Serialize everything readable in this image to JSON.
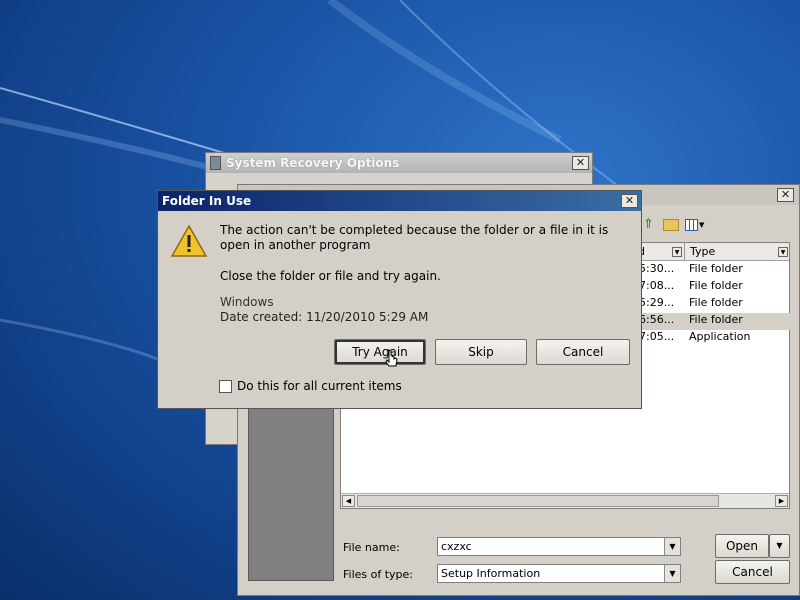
{
  "recovery_window": {
    "title": "System Recovery Options",
    "close": "✕"
  },
  "open_dialog": {
    "close": "✕",
    "columns": [
      {
        "label": "d",
        "name": "column-date-modified"
      },
      {
        "label": "Type",
        "name": "column-type"
      }
    ],
    "rows": [
      {
        "time": "5:30...",
        "type": "File folder"
      },
      {
        "time": "7:08...",
        "type": "File folder"
      },
      {
        "time": "5:29...",
        "type": "File folder"
      },
      {
        "time": "6:56...",
        "type": "File folder"
      },
      {
        "time": "7:05...",
        "type": "Application"
      }
    ],
    "file_name_label": "File name:",
    "file_name_value": "cxzxc",
    "files_of_type_label": "Files of type:",
    "files_of_type_value": "Setup Information",
    "open_button": "Open",
    "cancel_button": "Cancel"
  },
  "folder_in_use": {
    "title": "Folder In Use",
    "close": "✕",
    "message": "The action can't be completed because the folder or a file in it is open in another program",
    "instruction": "Close the folder or file and try again.",
    "item_name": "Windows",
    "item_date": "Date created: 11/20/2010 5:29 AM",
    "try_again": "Try Again",
    "skip": "Skip",
    "cancel": "Cancel",
    "checkbox_label": "Do this for all current items"
  },
  "colors": {
    "titlebar_active": "#0a246a",
    "titlebar_inactive": "#808080",
    "selection": "#d4d0c8"
  }
}
